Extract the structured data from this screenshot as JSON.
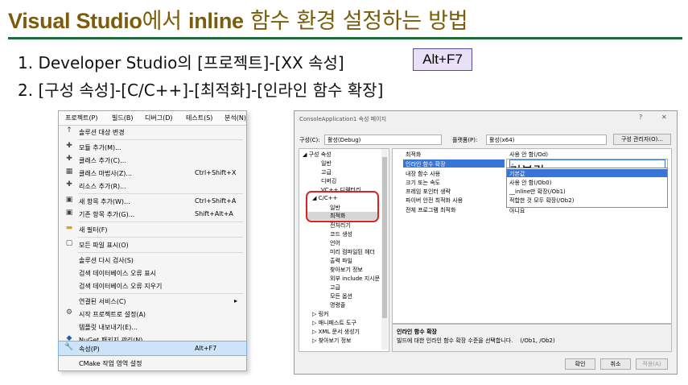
{
  "slide": {
    "title_en1": "Visual Studio",
    "title_ko1": "에서 ",
    "title_en2": "inline",
    "title_ko2": " 함수 환경 설정하는 방법",
    "step1": "1. Developer Studio의 [프로젝트]-[XX 속성]",
    "step1_badge": "Alt+F7",
    "step2": "2. [구성 속성]-[C/C++]-[최적화]-[인라인 함수 확장]"
  },
  "menu": {
    "bar": [
      "프로젝트(P)",
      "빌드(B)",
      "디버그(D)",
      "테스트(S)",
      "분석(N)"
    ],
    "items": [
      {
        "icon": "↑",
        "label": "솔루션 대상 변경",
        "shortcut": ""
      },
      {
        "icon": "✚",
        "label": "모듈 추가(M)...",
        "shortcut": ""
      },
      {
        "icon": "✚",
        "label": "클래스 추가(C)...",
        "shortcut": ""
      },
      {
        "icon": "▦",
        "label": "클래스 마법사(Z)...",
        "shortcut": "Ctrl+Shift+X"
      },
      {
        "icon": "✚",
        "label": "리소스 추가(R)...",
        "shortcut": ""
      },
      {
        "icon": "▣",
        "label": "새 항목 추가(W)...",
        "shortcut": "Ctrl+Shift+A"
      },
      {
        "icon": "▣",
        "label": "기존 항목 추가(G)...",
        "shortcut": "Shift+Alt+A"
      },
      {
        "icon": "▬",
        "label": "새 필터(F)",
        "shortcut": ""
      },
      {
        "icon": "▢",
        "label": "모든 파일 표시(O)",
        "shortcut": ""
      },
      {
        "icon": "",
        "label": "솔루션 다시 검사(S)",
        "shortcut": ""
      },
      {
        "icon": "",
        "label": "검색 데이터베이스 오류 표시",
        "shortcut": ""
      },
      {
        "icon": "",
        "label": "검색 데이터베이스 오류 지우기",
        "shortcut": ""
      },
      {
        "icon": "",
        "label": "연결된 서비스(C)",
        "shortcut": "",
        "submenu": "▸"
      },
      {
        "icon": "⚙",
        "label": "시작 프로젝트로 설정(A)",
        "shortcut": ""
      },
      {
        "icon": "",
        "label": "템플릿 내보내기(E)...",
        "shortcut": ""
      },
      {
        "icon": "◆",
        "label": "NuGet 패키지 관리(N)...",
        "shortcut": ""
      },
      {
        "icon": "🔧",
        "label": "속성(P)",
        "shortcut": "Alt+F7"
      },
      {
        "icon": "",
        "label": "CMake 작업 영역 설정",
        "shortcut": ""
      }
    ]
  },
  "dialog": {
    "title": "ConsoleApplication1 속성 페이지",
    "help": "?",
    "close": "✕",
    "config_label": "구성(C):",
    "config_value": "활성(Debug)",
    "platform_label": "플랫폼(P):",
    "platform_value": "활성(x64)",
    "config_manager": "구성 관리자(O)...",
    "tree": [
      "◢ 구성 속성",
      "일반",
      "고급",
      "디버깅",
      "VC++ 디렉터리",
      "◢ C/C++",
      "일반",
      "최적화",
      "전처리기",
      "코드 생성",
      "언어",
      "미리 컴파일된 헤더",
      "출력 파일",
      "찾아보기 정보",
      "외부 include 지시문",
      "고급",
      "모든 옵션",
      "명령줄",
      "▷ 링커",
      "▷ 매니페스트 도구",
      "▷ XML 문서 생성기",
      "▷ 찾아보기 정보"
    ],
    "props": [
      {
        "name": "최적화",
        "value": "사용 안 함(/Od)"
      },
      {
        "name": "인라인 함수 확장",
        "value": "기본값"
      },
      {
        "name": "내장 함수 사용",
        "value": ""
      },
      {
        "name": "크기 또는 속도",
        "value": ""
      },
      {
        "name": "프레임 포인터 생략",
        "value": ""
      },
      {
        "name": "파이버 안전 최적화 사용",
        "value": ""
      },
      {
        "name": "전체 프로그램 최적화",
        "value": "아니요"
      }
    ],
    "dropdown_options": [
      "기본값",
      "사용 안 함(/Ob0)",
      "__inline만 확장(/Ob1)",
      "적합한 것 모두 확장(/Ob2)"
    ],
    "desc_title": "인라인 함수 확장",
    "desc_text": "빌드에 대한 인라인 함수 확장 수준을 선택합니다.    (/Ob1, /Ob2)",
    "ok": "확인",
    "cancel": "취소",
    "apply": "적용(A)"
  },
  "colors": {
    "title": "#7a5c0a",
    "rule": "#1e6b3a",
    "highlight": "#e02020",
    "selection": "#3875d7"
  }
}
